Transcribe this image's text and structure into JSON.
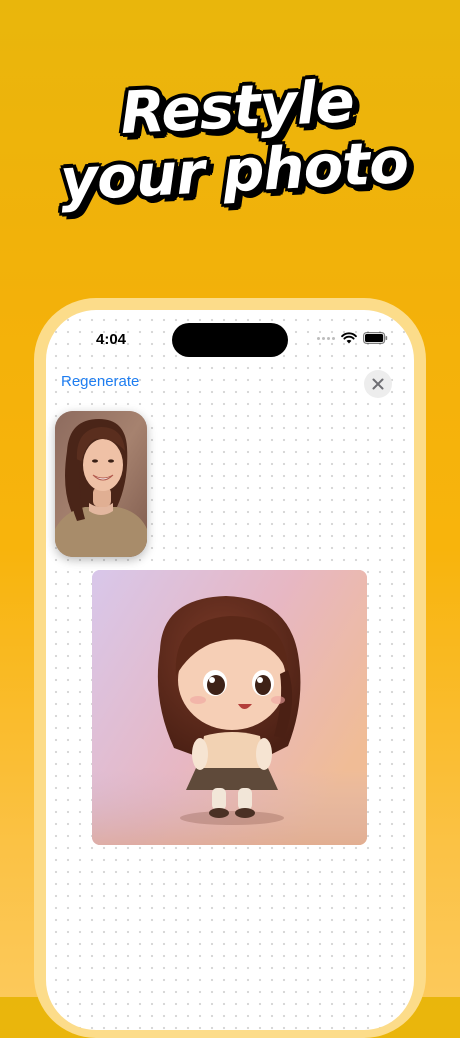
{
  "headline": {
    "line1": "Restyle",
    "line2": "your photo"
  },
  "status_bar": {
    "time": "4:04"
  },
  "toolbar": {
    "regenerate_label": "Regenerate"
  },
  "icons": {
    "close": "close-icon",
    "wifi": "wifi-icon",
    "battery": "battery-icon",
    "signal": "cellular-signal-icon"
  },
  "colors": {
    "background_top": "#E9B60C",
    "background_bottom": "#FCC95A",
    "phone_frame": "#FCDC8A",
    "link": "#1E7DF0"
  }
}
